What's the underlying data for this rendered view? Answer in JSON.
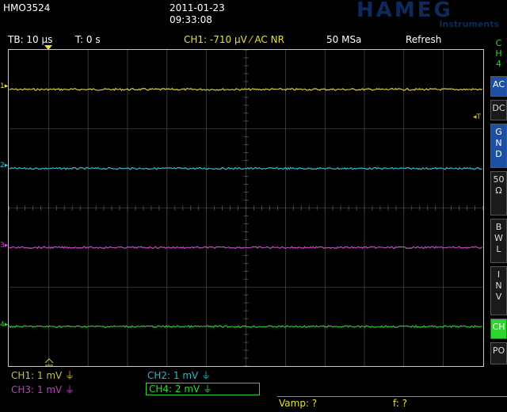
{
  "header": {
    "model": "HMO3524",
    "date": "2011-01-23",
    "time": "09:33:08",
    "logo_text": "HAMEG",
    "logo_sub": "Instruments"
  },
  "status": {
    "timebase": "TB: 10 µs",
    "trigger_time": "T: 0 s",
    "ch1_info": "CH1: -710 µV ⁄ AC NR",
    "sample_rate": "50 MSa",
    "mode": "Refresh"
  },
  "channels": [
    {
      "id": "CH1",
      "marker": "1",
      "color": "#e6e23a",
      "setting": "CH1: 1 mV ⏚",
      "level": 0.125
    },
    {
      "id": "CH2",
      "marker": "2",
      "color": "#2bc7d8",
      "setting": "CH2: 1 mV ⏚",
      "level": 0.375
    },
    {
      "id": "CH3",
      "marker": "3",
      "color": "#d43ed4",
      "setting": "CH3: 1 mV ⏚",
      "level": 0.625
    },
    {
      "id": "CH4",
      "marker": "4",
      "color": "#2fd52f",
      "setting": "CH4: 2 mV ⏚",
      "level": 0.875
    }
  ],
  "side_menu": {
    "channel_tab": [
      "C",
      "H",
      "4"
    ],
    "buttons": [
      {
        "label": [
          "AC"
        ],
        "active": true
      },
      {
        "label": [
          "DC"
        ],
        "active": false
      },
      {
        "label": [
          "G",
          "N",
          "D"
        ],
        "active": true
      },
      {
        "label": [
          "50",
          "Ω"
        ],
        "active": false
      },
      {
        "label": [
          "B",
          "W",
          "L"
        ],
        "active": false
      },
      {
        "label": [
          "I",
          "N",
          "V"
        ],
        "active": false
      },
      {
        "label": [
          "CH"
        ],
        "active": true,
        "green": true
      },
      {
        "label": [
          "PO"
        ],
        "active": false
      }
    ]
  },
  "trigger_marker": "◂T",
  "measurements": {
    "vamp": "Vamp: ?",
    "freq": "f: ?"
  },
  "colors": {
    "grid": "#5a5a5a",
    "active_button": "#1d4fa3",
    "green_button": "#2fd52f"
  }
}
